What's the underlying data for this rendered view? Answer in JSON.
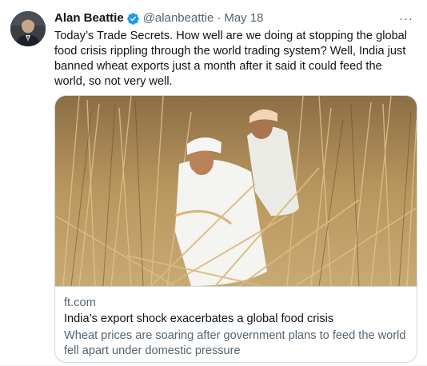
{
  "tweet": {
    "author_name": "Alan Beattie",
    "handle": "@alanbeattie",
    "separator": "·",
    "date": "May 18",
    "more_label": "···",
    "text": "Today’s Trade Secrets. How well are we doing at stopping the global food crisis rippling through the world trading system? Well, India just banned wheat exports just a month after it said it could feed the world, so not very well."
  },
  "card": {
    "domain": "ft.com",
    "title": "India’s export shock exacerbates a global food crisis",
    "description": "Wheat prices are soaring after government plans to feed the world fell apart under domestic pressure"
  },
  "colors": {
    "verified": "#1d9bf0",
    "secondary_text": "#536471",
    "primary_text": "#0f1419",
    "border": "#cfd9de"
  },
  "icons": {
    "verified": "verified-badge-icon",
    "more": "more-options-icon"
  }
}
